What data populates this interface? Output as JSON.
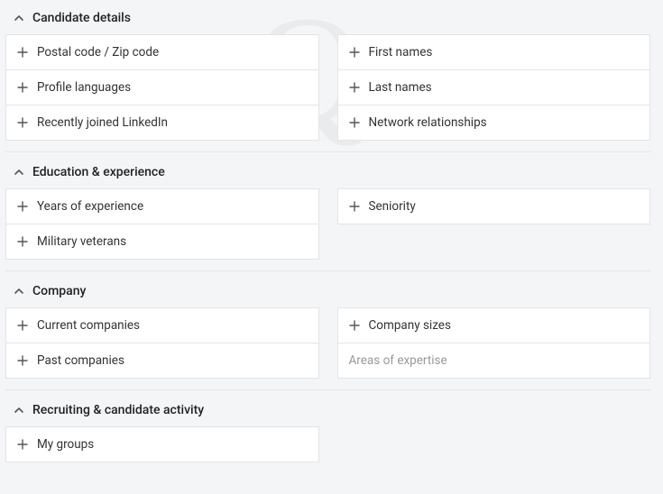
{
  "sections": {
    "candidate_details": {
      "title": "Candidate details",
      "left": [
        {
          "label": "Postal code / Zip code"
        },
        {
          "label": "Profile languages"
        },
        {
          "label": "Recently joined LinkedIn"
        }
      ],
      "right": [
        {
          "label": "First names"
        },
        {
          "label": "Last names"
        },
        {
          "label": "Network relationships"
        }
      ]
    },
    "education_experience": {
      "title": "Education & experience",
      "left": [
        {
          "label": "Years of experience"
        },
        {
          "label": "Military veterans"
        }
      ],
      "right": [
        {
          "label": "Seniority"
        }
      ]
    },
    "company": {
      "title": "Company",
      "left": [
        {
          "label": "Current companies"
        },
        {
          "label": "Past companies"
        }
      ],
      "right": [
        {
          "label": "Company sizes"
        }
      ],
      "right_input_placeholder": "Areas of expertise"
    },
    "recruiting_activity": {
      "title": "Recruiting & candidate activity",
      "left": [
        {
          "label": "My groups"
        }
      ]
    }
  }
}
